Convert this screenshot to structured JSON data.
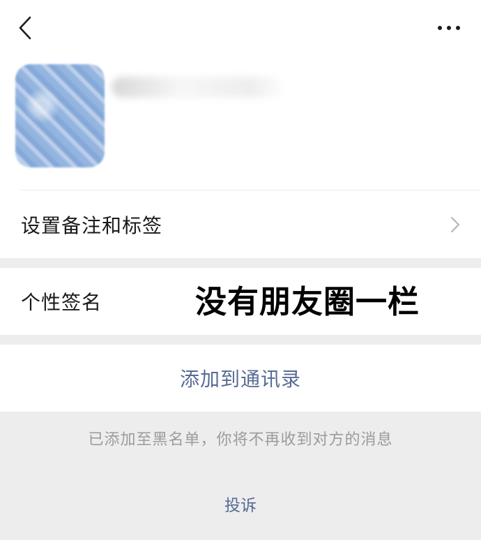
{
  "nav": {
    "back_icon": "chevron-left-icon",
    "more_icon": "more-dots-icon"
  },
  "profile": {
    "avatar": "avatar-blurred",
    "name_obscured": true
  },
  "settings": {
    "remark_label": "设置备注和标签",
    "remark_icon": "chevron-right-icon"
  },
  "signature": {
    "label": "个性签名"
  },
  "annotation": {
    "text": "没有朋友圈一栏"
  },
  "actions": {
    "add_contact": "添加到通讯录"
  },
  "blacklist": {
    "note": "已添加至黑名单，你将不再收到对方的消息"
  },
  "footer": {
    "complain": "投诉"
  },
  "colors": {
    "link": "#576b95",
    "background": "#ededed",
    "muted": "#9b9b9b"
  }
}
